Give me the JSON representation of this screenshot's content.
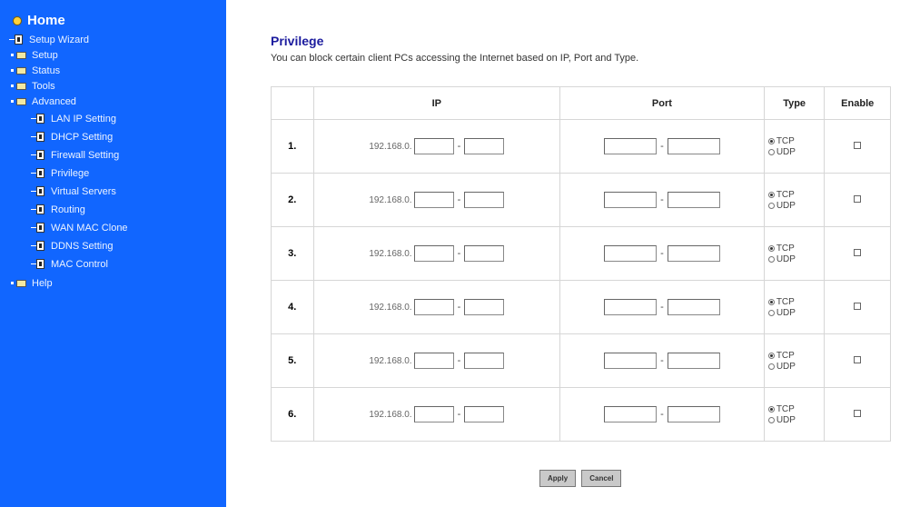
{
  "sidebar": {
    "home_label": "Home",
    "items": [
      {
        "label": "Setup Wizard",
        "icon": "page-icon"
      },
      {
        "label": "Setup",
        "icon": "folder-icon"
      },
      {
        "label": "Status",
        "icon": "folder-icon"
      },
      {
        "label": "Tools",
        "icon": "folder-icon"
      },
      {
        "label": "Advanced",
        "icon": "folder-icon"
      },
      {
        "label": "LAN IP Setting",
        "icon": "page-icon"
      },
      {
        "label": "DHCP Setting",
        "icon": "page-icon"
      },
      {
        "label": "Firewall Setting",
        "icon": "page-icon"
      },
      {
        "label": "Privilege",
        "icon": "page-icon"
      },
      {
        "label": "Virtual Servers",
        "icon": "page-icon"
      },
      {
        "label": "Routing",
        "icon": "page-icon"
      },
      {
        "label": "WAN MAC Clone",
        "icon": "page-icon"
      },
      {
        "label": "DDNS Setting",
        "icon": "page-icon"
      },
      {
        "label": "MAC Control",
        "icon": "page-icon"
      },
      {
        "label": "Help",
        "icon": "folder-icon"
      }
    ]
  },
  "main": {
    "title": "Privilege",
    "description": "You can block certain client PCs accessing the Internet based on IP, Port and Type.",
    "table": {
      "headers": {
        "ip": "IP",
        "port": "Port",
        "type": "Type",
        "enable": "Enable"
      },
      "rows": [
        {
          "no": "1.",
          "ip_prefix": "192.168.0.",
          "tcp": "TCP",
          "udp": "UDP",
          "type_selected": "TCP",
          "enabled": false
        },
        {
          "no": "2.",
          "ip_prefix": "192.168.0.",
          "tcp": "TCP",
          "udp": "UDP",
          "type_selected": "TCP",
          "enabled": false
        },
        {
          "no": "3.",
          "ip_prefix": "192.168.0.",
          "tcp": "TCP",
          "udp": "UDP",
          "type_selected": "TCP",
          "enabled": false
        },
        {
          "no": "4.",
          "ip_prefix": "192.168.0.",
          "tcp": "TCP",
          "udp": "UDP",
          "type_selected": "TCP",
          "enabled": false
        },
        {
          "no": "5.",
          "ip_prefix": "192.168.0.",
          "tcp": "TCP",
          "udp": "UDP",
          "type_selected": "TCP",
          "enabled": false
        },
        {
          "no": "6.",
          "ip_prefix": "192.168.0.",
          "tcp": "TCP",
          "udp": "UDP",
          "type_selected": "TCP",
          "enabled": false
        }
      ]
    }
  },
  "buttons": {
    "apply": "Apply",
    "cancel": "Cancel"
  },
  "colors": {
    "sidebar_bg": "#1166ff",
    "title": "#1b1b9e"
  }
}
